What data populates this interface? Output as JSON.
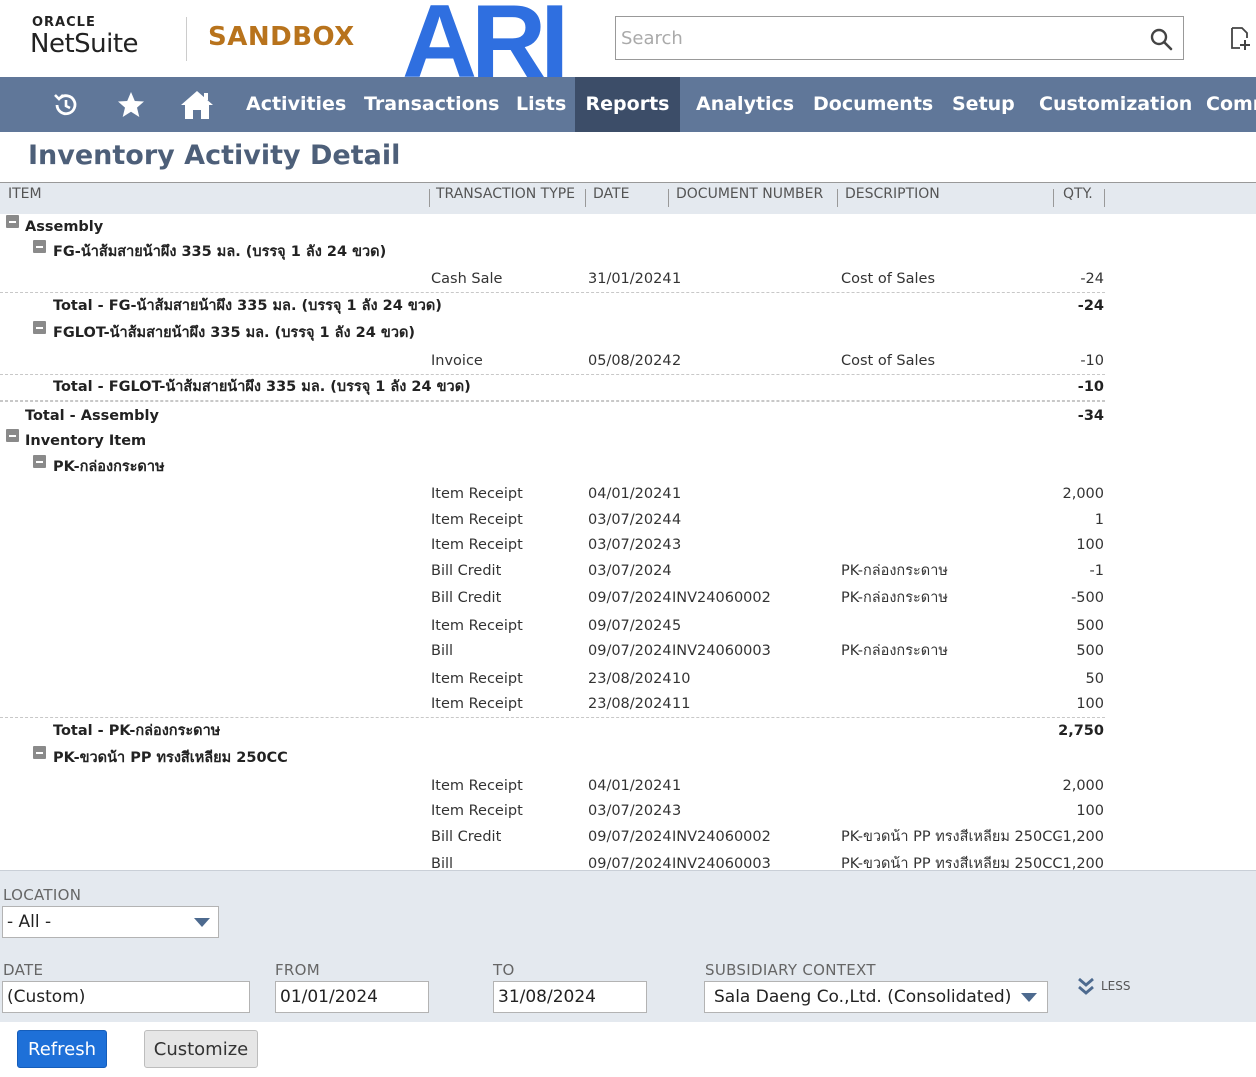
{
  "header": {
    "brand_small": "ORACLE",
    "brand_large": "NetSuite",
    "environment": "SANDBOX",
    "company_logo_text": "ARI",
    "search_placeholder": "Search"
  },
  "nav": {
    "items": [
      {
        "label": "Activities",
        "active": false
      },
      {
        "label": "Transactions",
        "active": false
      },
      {
        "label": "Lists",
        "active": false
      },
      {
        "label": "Reports",
        "active": true
      },
      {
        "label": "Analytics",
        "active": false
      },
      {
        "label": "Documents",
        "active": false
      },
      {
        "label": "Setup",
        "active": false
      },
      {
        "label": "Customization",
        "active": false
      },
      {
        "label": "Comm",
        "active": false
      }
    ]
  },
  "page": {
    "title": "Inventory Activity Detail"
  },
  "report": {
    "columns": [
      "ITEM",
      "TRANSACTION TYPE",
      "DATE",
      "DOCUMENT NUMBER",
      "DESCRIPTION",
      "QTY."
    ],
    "rows": [
      {
        "kind": "group",
        "level": 0,
        "label": "Assembly"
      },
      {
        "kind": "group",
        "level": 1,
        "label": "FG-น้าส้มสายน้าผึง 335 มล. (บรรจุ 1 ลัง 24 ขวด)"
      },
      {
        "kind": "detail",
        "type": "Cash Sale",
        "date": "31/01/2024",
        "doc": "1",
        "desc": "Cost of Sales",
        "qty": "-24"
      },
      {
        "kind": "total",
        "level": 1,
        "label": "Total - FG-น้าส้มสายน้าผึง 335 มล. (บรรจุ 1 ลัง 24 ขวด)",
        "qty": "-24"
      },
      {
        "kind": "group",
        "level": 1,
        "label": "FGLOT-น้าส้มสายน้าผึง 335 มล. (บรรจุ 1 ลัง 24 ขวด)"
      },
      {
        "kind": "detail",
        "type": "Invoice",
        "date": "05/08/2024",
        "doc": "2",
        "desc": "Cost of Sales",
        "qty": "-10"
      },
      {
        "kind": "total",
        "level": 1,
        "label": "Total - FGLOT-น้าส้มสายน้าผึง 335 มล. (บรรจุ 1 ลัง 24 ขวด)",
        "qty": "-10"
      },
      {
        "kind": "total",
        "level": 0,
        "label": "Total - Assembly",
        "qty": "-34"
      },
      {
        "kind": "group",
        "level": 0,
        "label": "Inventory Item"
      },
      {
        "kind": "group",
        "level": 1,
        "label": "PK-กล่องกระดาษ"
      },
      {
        "kind": "detail",
        "type": "Item Receipt",
        "date": "04/01/2024",
        "doc": "1",
        "desc": "",
        "qty": "2,000"
      },
      {
        "kind": "detail",
        "type": "Item Receipt",
        "date": "03/07/2024",
        "doc": "4",
        "desc": "",
        "qty": "1"
      },
      {
        "kind": "detail",
        "type": "Item Receipt",
        "date": "03/07/2024",
        "doc": "3",
        "desc": "",
        "qty": "100"
      },
      {
        "kind": "detail",
        "type": "Bill Credit",
        "date": "03/07/2024",
        "doc": "",
        "desc": "PK-กล่องกระดาษ",
        "qty": "-1"
      },
      {
        "kind": "detail",
        "type": "Bill Credit",
        "date": "09/07/2024",
        "doc": "INV24060002",
        "desc": "PK-กล่องกระดาษ",
        "qty": "-500"
      },
      {
        "kind": "detail",
        "type": "Item Receipt",
        "date": "09/07/2024",
        "doc": "5",
        "desc": "",
        "qty": "500"
      },
      {
        "kind": "detail",
        "type": "Bill",
        "date": "09/07/2024",
        "doc": "INV24060003",
        "desc": "PK-กล่องกระดาษ",
        "qty": "500"
      },
      {
        "kind": "detail",
        "type": "Item Receipt",
        "date": "23/08/2024",
        "doc": "10",
        "desc": "",
        "qty": "50"
      },
      {
        "kind": "detail",
        "type": "Item Receipt",
        "date": "23/08/2024",
        "doc": "11",
        "desc": "",
        "qty": "100"
      },
      {
        "kind": "total",
        "level": 1,
        "label": "Total - PK-กล่องกระดาษ",
        "qty": "2,750"
      },
      {
        "kind": "group",
        "level": 1,
        "label": "PK-ขวดน้า PP ทรงสีเหลียม 250CC"
      },
      {
        "kind": "detail",
        "type": "Item Receipt",
        "date": "04/01/2024",
        "doc": "1",
        "desc": "",
        "qty": "2,000"
      },
      {
        "kind": "detail",
        "type": "Item Receipt",
        "date": "03/07/2024",
        "doc": "3",
        "desc": "",
        "qty": "100"
      },
      {
        "kind": "detail",
        "type": "Bill Credit",
        "date": "09/07/2024",
        "doc": "INV24060002",
        "desc": "PK-ขวดน้า PP ทรงสีเหลียม 250CC",
        "qty": "-1,200"
      },
      {
        "kind": "detail",
        "type": "Bill",
        "date": "09/07/2024",
        "doc": "INV24060003",
        "desc": "PK-ขวดน้า PP ทรงสีเหลียม 250CC",
        "qty": "1,200"
      }
    ]
  },
  "filters": {
    "location": {
      "label": "LOCATION",
      "value": "- All -"
    },
    "date": {
      "label": "DATE",
      "value": "(Custom)"
    },
    "from": {
      "label": "FROM",
      "value": "01/01/2024"
    },
    "to": {
      "label": "TO",
      "value": "31/08/2024"
    },
    "subsidiary": {
      "label": "SUBSIDIARY CONTEXT",
      "value": "Sala Daeng Co.,Ltd. (Consolidated)"
    },
    "less_label": "LESS"
  },
  "buttons": {
    "refresh": "Refresh",
    "customize": "Customize"
  },
  "colors": {
    "nav_bg": "#607799",
    "nav_active": "#3c4d68",
    "title": "#4d5f79",
    "sandbox": "#b8731c",
    "logo_blue": "#2f6fe0",
    "primary_button": "#1e70d8"
  }
}
